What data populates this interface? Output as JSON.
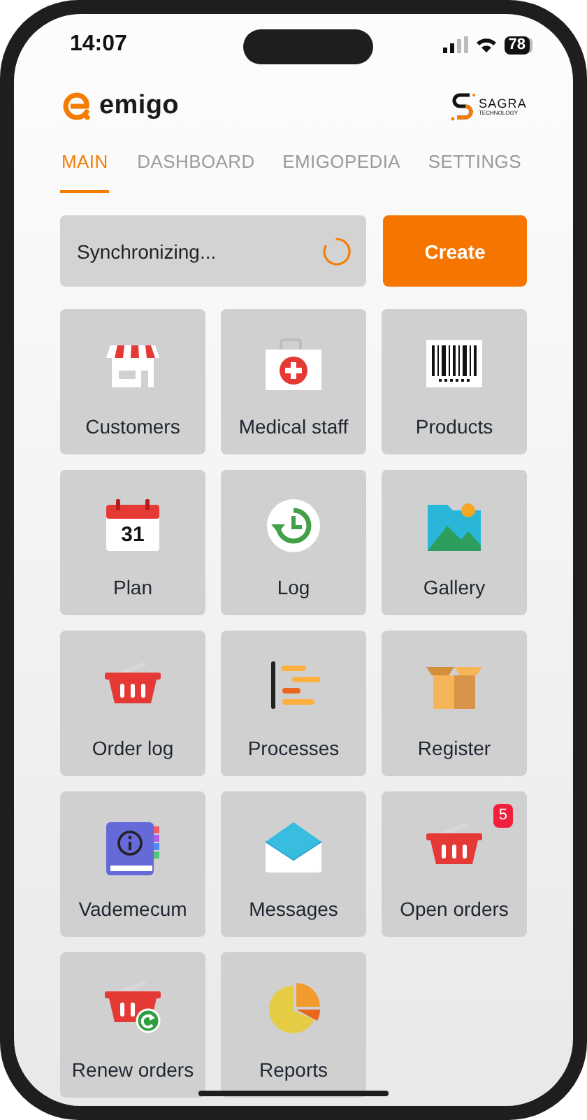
{
  "status_bar": {
    "time": "14:07",
    "battery": "78"
  },
  "header": {
    "app_name": "emigo",
    "partner_name": "SAGRA",
    "partner_tagline": "TECHNOLOGY"
  },
  "tabs": [
    {
      "label": "MAIN",
      "selected": true
    },
    {
      "label": "DASHBOARD",
      "selected": false
    },
    {
      "label": "EMIGOPEDIA",
      "selected": false
    },
    {
      "label": "SETTINGS",
      "selected": false
    }
  ],
  "sync": {
    "label": "Synchronizing..."
  },
  "create_button": {
    "label": "Create"
  },
  "tiles": [
    {
      "label": "Customers",
      "kind": "shop"
    },
    {
      "label": "Medical staff",
      "kind": "medkit"
    },
    {
      "label": "Products",
      "kind": "barcode"
    },
    {
      "label": "Plan",
      "kind": "calendar",
      "icon_text": "31"
    },
    {
      "label": "Log",
      "kind": "history"
    },
    {
      "label": "Gallery",
      "kind": "gallery"
    },
    {
      "label": "Order log",
      "kind": "basket"
    },
    {
      "label": "Processes",
      "kind": "gantt"
    },
    {
      "label": "Register",
      "kind": "box"
    },
    {
      "label": "Vademecum",
      "kind": "book"
    },
    {
      "label": "Messages",
      "kind": "envelope"
    },
    {
      "label": "Open orders",
      "kind": "basket",
      "badge": "5"
    },
    {
      "label": "Renew orders",
      "kind": "renew"
    },
    {
      "label": "Reports",
      "kind": "pie"
    }
  ]
}
